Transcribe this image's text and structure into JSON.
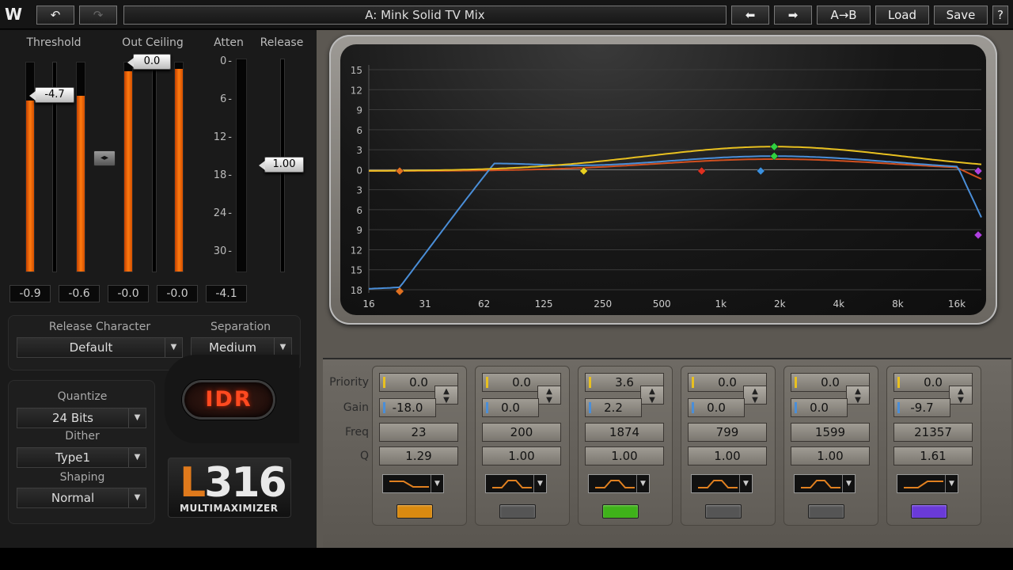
{
  "topbar": {
    "preset_name": "A: Mink Solid TV Mix",
    "ab_label": "A→B",
    "load_label": "Load",
    "save_label": "Save",
    "help_label": "?",
    "undo_glyph": "↶",
    "redo_glyph": "↷",
    "prev_glyph": "⬅",
    "next_glyph": "➡",
    "logo_glyph": "W"
  },
  "meters": {
    "threshold_label": "Threshold",
    "out_ceiling_label": "Out Ceiling",
    "atten_label": "Atten",
    "release_label": "Release",
    "threshold_value": "-4.7",
    "out_ceiling_value": "0.0",
    "release_value": "1.00",
    "link_glyph": "◂▸",
    "atten_ticks": [
      "0",
      "6",
      "12",
      "18",
      "24",
      "30"
    ],
    "readouts": [
      "-0.9",
      "-0.6",
      "-0.0",
      "-0.0",
      "-4.1"
    ],
    "threshold_left_level": 0.82,
    "threshold_right_level": 0.84,
    "ceiling_left_level": 0.96,
    "ceiling_right_level": 0.97,
    "atten_level": 0.0
  },
  "release_group": {
    "character_label": "Release Character",
    "character_value": "Default",
    "separation_label": "Separation",
    "separation_value": "Medium"
  },
  "dither_group": {
    "quantize_label": "Quantize",
    "quantize_value": "24 Bits",
    "dither_label": "Dither",
    "dither_value": "Type1",
    "shaping_label": "Shaping",
    "shaping_value": "Normal"
  },
  "idr_label": "IDR",
  "brand": {
    "main_l": "L",
    "main_rest": "316",
    "sub": "MULTIMAXIMIZER"
  },
  "row_labels": {
    "priority": "Priority",
    "gain": "Gain",
    "freq": "Freq",
    "q": "Q"
  },
  "bands": [
    {
      "priority": "0.0",
      "gain": "-18.0",
      "freq": "23",
      "q": "1.29",
      "shape": "low-shelf",
      "color": "#d98a10"
    },
    {
      "priority": "0.0",
      "gain": "0.0",
      "freq": "200",
      "q": "1.00",
      "shape": "bell",
      "color": "#555555"
    },
    {
      "priority": "3.6",
      "gain": "2.2",
      "freq": "1874",
      "q": "1.00",
      "shape": "bell",
      "color": "#3fb21a"
    },
    {
      "priority": "0.0",
      "gain": "0.0",
      "freq": "799",
      "q": "1.00",
      "shape": "bell",
      "color": "#555555"
    },
    {
      "priority": "0.0",
      "gain": "0.0",
      "freq": "1599",
      "q": "1.00",
      "shape": "bell",
      "color": "#555555"
    },
    {
      "priority": "0.0",
      "gain": "-9.7",
      "freq": "21357",
      "q": "1.61",
      "shape": "high-shelf",
      "color": "#6a3ad8"
    }
  ],
  "graph": {
    "y_ticks": [
      "15",
      "12",
      "9",
      "6",
      "3",
      "0",
      "3",
      "6",
      "9",
      "12",
      "15",
      "18"
    ],
    "x_ticks": [
      "16",
      "31",
      "62",
      "125",
      "250",
      "500",
      "1k",
      "2k",
      "4k",
      "8k",
      "16k"
    ],
    "colors": {
      "priority_curve": "#e8c020",
      "gain_curve": "#4a8ed8",
      "combined_curve": "#d05020"
    },
    "markers": [
      {
        "freq": 23,
        "db": 0,
        "color": "#e07020"
      },
      {
        "freq": 200,
        "db": 0,
        "color": "#e8d020"
      },
      {
        "freq": 799,
        "db": 0,
        "color": "#e03020"
      },
      {
        "freq": 1599,
        "db": 0,
        "color": "#3a90e0"
      },
      {
        "freq": 1874,
        "db": 2.2,
        "color": "#30d040"
      },
      {
        "freq": 1874,
        "db": 3.6,
        "color": "#30d040"
      },
      {
        "freq": 21357,
        "db": 0,
        "color": "#b040e0"
      },
      {
        "freq": 21357,
        "db": -9.7,
        "color": "#b040e0"
      }
    ]
  }
}
